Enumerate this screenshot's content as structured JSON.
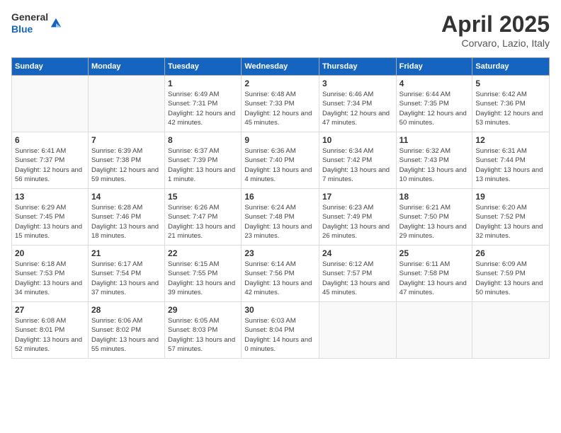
{
  "header": {
    "logo_general": "General",
    "logo_blue": "Blue",
    "month_title": "April 2025",
    "location": "Corvaro, Lazio, Italy"
  },
  "weekdays": [
    "Sunday",
    "Monday",
    "Tuesday",
    "Wednesday",
    "Thursday",
    "Friday",
    "Saturday"
  ],
  "weeks": [
    [
      {
        "day": "",
        "info": ""
      },
      {
        "day": "",
        "info": ""
      },
      {
        "day": "1",
        "info": "Sunrise: 6:49 AM\nSunset: 7:31 PM\nDaylight: 12 hours and 42 minutes."
      },
      {
        "day": "2",
        "info": "Sunrise: 6:48 AM\nSunset: 7:33 PM\nDaylight: 12 hours and 45 minutes."
      },
      {
        "day": "3",
        "info": "Sunrise: 6:46 AM\nSunset: 7:34 PM\nDaylight: 12 hours and 47 minutes."
      },
      {
        "day": "4",
        "info": "Sunrise: 6:44 AM\nSunset: 7:35 PM\nDaylight: 12 hours and 50 minutes."
      },
      {
        "day": "5",
        "info": "Sunrise: 6:42 AM\nSunset: 7:36 PM\nDaylight: 12 hours and 53 minutes."
      }
    ],
    [
      {
        "day": "6",
        "info": "Sunrise: 6:41 AM\nSunset: 7:37 PM\nDaylight: 12 hours and 56 minutes."
      },
      {
        "day": "7",
        "info": "Sunrise: 6:39 AM\nSunset: 7:38 PM\nDaylight: 12 hours and 59 minutes."
      },
      {
        "day": "8",
        "info": "Sunrise: 6:37 AM\nSunset: 7:39 PM\nDaylight: 13 hours and 1 minute."
      },
      {
        "day": "9",
        "info": "Sunrise: 6:36 AM\nSunset: 7:40 PM\nDaylight: 13 hours and 4 minutes."
      },
      {
        "day": "10",
        "info": "Sunrise: 6:34 AM\nSunset: 7:42 PM\nDaylight: 13 hours and 7 minutes."
      },
      {
        "day": "11",
        "info": "Sunrise: 6:32 AM\nSunset: 7:43 PM\nDaylight: 13 hours and 10 minutes."
      },
      {
        "day": "12",
        "info": "Sunrise: 6:31 AM\nSunset: 7:44 PM\nDaylight: 13 hours and 13 minutes."
      }
    ],
    [
      {
        "day": "13",
        "info": "Sunrise: 6:29 AM\nSunset: 7:45 PM\nDaylight: 13 hours and 15 minutes."
      },
      {
        "day": "14",
        "info": "Sunrise: 6:28 AM\nSunset: 7:46 PM\nDaylight: 13 hours and 18 minutes."
      },
      {
        "day": "15",
        "info": "Sunrise: 6:26 AM\nSunset: 7:47 PM\nDaylight: 13 hours and 21 minutes."
      },
      {
        "day": "16",
        "info": "Sunrise: 6:24 AM\nSunset: 7:48 PM\nDaylight: 13 hours and 23 minutes."
      },
      {
        "day": "17",
        "info": "Sunrise: 6:23 AM\nSunset: 7:49 PM\nDaylight: 13 hours and 26 minutes."
      },
      {
        "day": "18",
        "info": "Sunrise: 6:21 AM\nSunset: 7:50 PM\nDaylight: 13 hours and 29 minutes."
      },
      {
        "day": "19",
        "info": "Sunrise: 6:20 AM\nSunset: 7:52 PM\nDaylight: 13 hours and 32 minutes."
      }
    ],
    [
      {
        "day": "20",
        "info": "Sunrise: 6:18 AM\nSunset: 7:53 PM\nDaylight: 13 hours and 34 minutes."
      },
      {
        "day": "21",
        "info": "Sunrise: 6:17 AM\nSunset: 7:54 PM\nDaylight: 13 hours and 37 minutes."
      },
      {
        "day": "22",
        "info": "Sunrise: 6:15 AM\nSunset: 7:55 PM\nDaylight: 13 hours and 39 minutes."
      },
      {
        "day": "23",
        "info": "Sunrise: 6:14 AM\nSunset: 7:56 PM\nDaylight: 13 hours and 42 minutes."
      },
      {
        "day": "24",
        "info": "Sunrise: 6:12 AM\nSunset: 7:57 PM\nDaylight: 13 hours and 45 minutes."
      },
      {
        "day": "25",
        "info": "Sunrise: 6:11 AM\nSunset: 7:58 PM\nDaylight: 13 hours and 47 minutes."
      },
      {
        "day": "26",
        "info": "Sunrise: 6:09 AM\nSunset: 7:59 PM\nDaylight: 13 hours and 50 minutes."
      }
    ],
    [
      {
        "day": "27",
        "info": "Sunrise: 6:08 AM\nSunset: 8:01 PM\nDaylight: 13 hours and 52 minutes."
      },
      {
        "day": "28",
        "info": "Sunrise: 6:06 AM\nSunset: 8:02 PM\nDaylight: 13 hours and 55 minutes."
      },
      {
        "day": "29",
        "info": "Sunrise: 6:05 AM\nSunset: 8:03 PM\nDaylight: 13 hours and 57 minutes."
      },
      {
        "day": "30",
        "info": "Sunrise: 6:03 AM\nSunset: 8:04 PM\nDaylight: 14 hours and 0 minutes."
      },
      {
        "day": "",
        "info": ""
      },
      {
        "day": "",
        "info": ""
      },
      {
        "day": "",
        "info": ""
      }
    ]
  ]
}
